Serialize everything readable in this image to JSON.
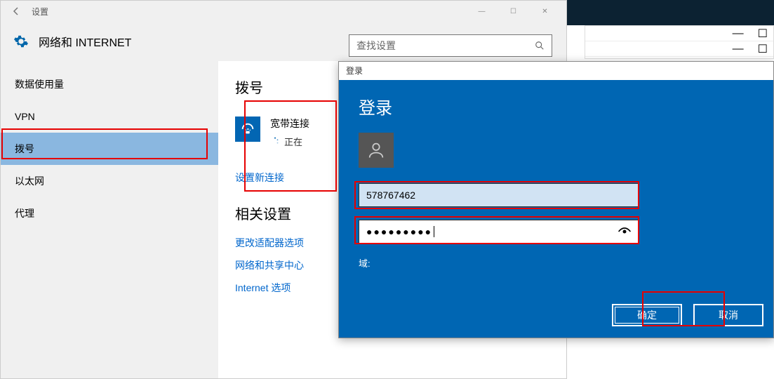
{
  "settings": {
    "window_title": "设置",
    "header_title": "网络和 INTERNET",
    "search_placeholder": "查找设置",
    "sidebar": [
      {
        "label": "数据使用量"
      },
      {
        "label": "VPN"
      },
      {
        "label": "拨号"
      },
      {
        "label": "以太网"
      },
      {
        "label": "代理"
      }
    ],
    "selected_index": 2,
    "main": {
      "section_dial": "拨号",
      "connection_name": "宽带连接",
      "connection_status": "正在",
      "new_connection": "设置新连接",
      "related_title": "相关设置",
      "links": [
        "更改适配器选项",
        "网络和共享中心",
        "Internet 选项"
      ]
    }
  },
  "login": {
    "titlebar": "登录",
    "heading": "登录",
    "username": "578767462",
    "password_masked": "●●●●●●●●●",
    "domain_label": "域:",
    "ok": "确定",
    "cancel": "取消"
  }
}
